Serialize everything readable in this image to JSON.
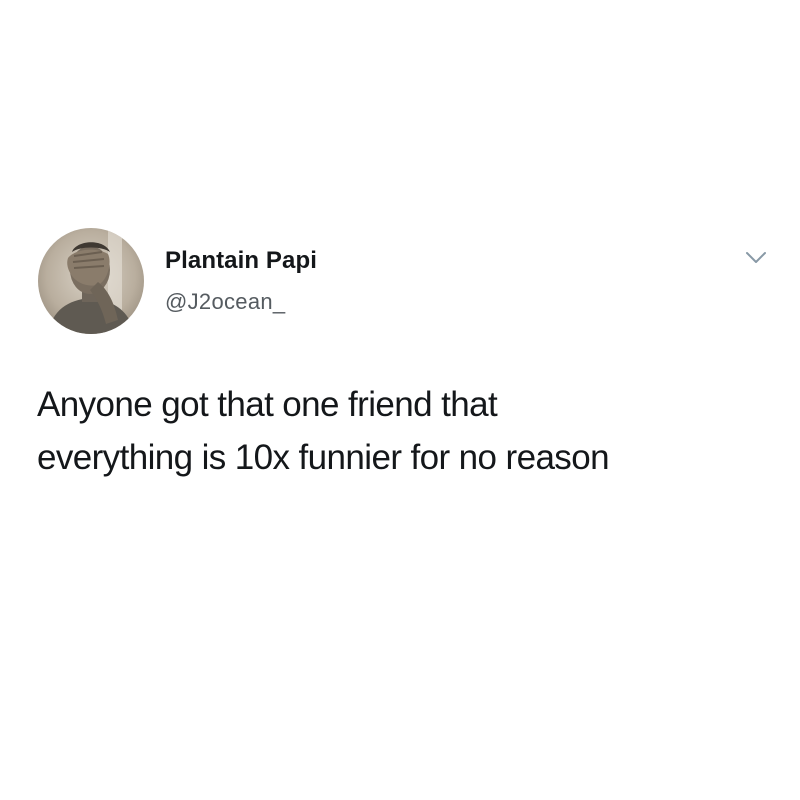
{
  "tweet": {
    "display_name": "Plantain Papi",
    "handle": "@J2ocean_",
    "text_lines": [
      "Anyone got that one friend that",
      "everything is 10x funnier for no reason"
    ],
    "avatar_icon": "profile-photo",
    "menu_icon": "chevron-down-icon"
  },
  "colors": {
    "background": "#ffffff",
    "text_primary": "#14171a",
    "text_secondary": "#555b60",
    "chevron": "#8899a6"
  }
}
